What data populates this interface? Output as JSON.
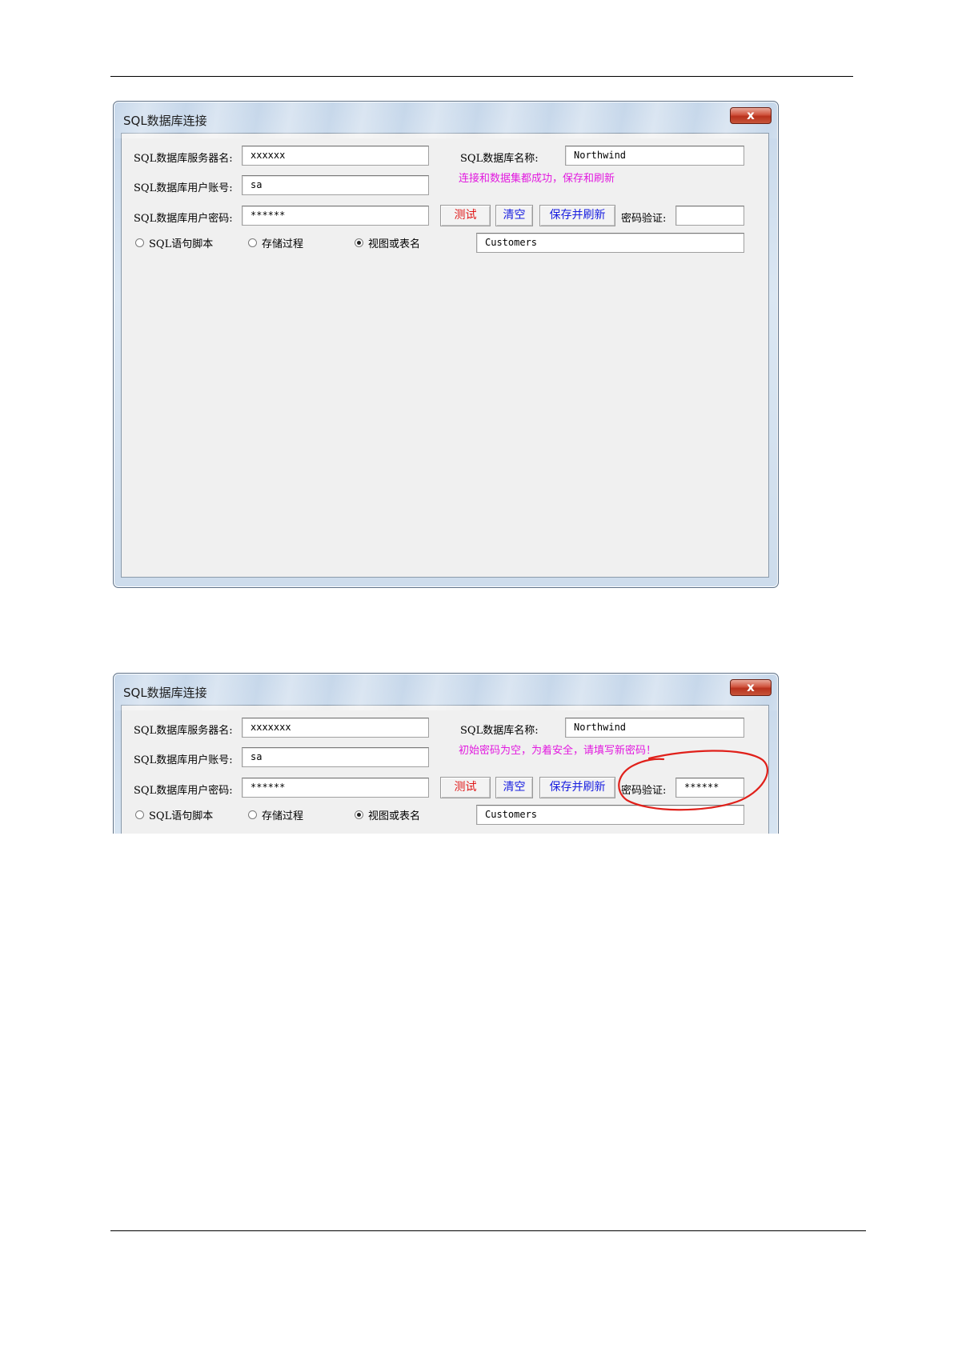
{
  "dialog_title": "SQL数据库连接",
  "close_symbol": "x",
  "labels": {
    "server": "SQL数据库服务器名:",
    "account": "SQL数据库用户账号:",
    "password": "SQL数据库用户密码:",
    "dbname": "SQL数据库名称:",
    "verify": "密码验证:"
  },
  "buttons": {
    "test": "测试",
    "clear": "清空",
    "save_refresh": "保存并刷新"
  },
  "radios": {
    "sql_script": "SQL语句脚本",
    "stored_proc": "存储过程",
    "view_table": "视图或表名"
  },
  "screenshot1": {
    "server_value": "xxxxxx",
    "account_value": "sa",
    "password_value": "******",
    "dbname_value": "Northwind",
    "verify_value": "",
    "table_value": "Customers",
    "status_message": "连接和数据集都成功，保存和刷新"
  },
  "screenshot2": {
    "server_value": "xxxxxxx",
    "account_value": "sa",
    "password_value": "******",
    "dbname_value": "Northwind",
    "verify_value": "******",
    "table_value": "Customers",
    "status_message": "初始密码为空，为着安全，请填写新密码！"
  },
  "colors": {
    "status_text": "#e21adf",
    "test_button_text": "#e01818",
    "action_button_text": "#1a20e0",
    "annotation_circle": "#e0201a"
  }
}
